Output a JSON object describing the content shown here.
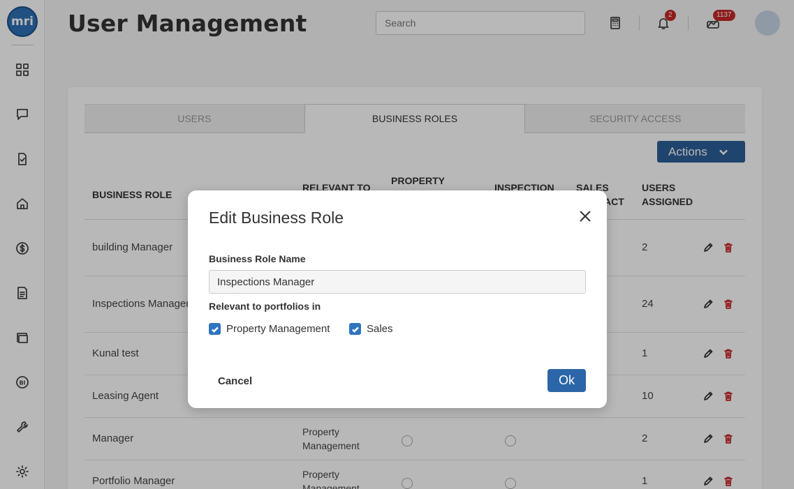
{
  "app": {
    "logo_text": "mri"
  },
  "header": {
    "title": "User Management",
    "search_placeholder": "Search",
    "notifications_count": "2",
    "tasks_count": "1137"
  },
  "sidebar": {
    "items": [
      {
        "icon": "dashboard-icon"
      },
      {
        "icon": "chat-icon"
      },
      {
        "icon": "checklist-icon"
      },
      {
        "icon": "home-icon"
      },
      {
        "icon": "dollar-icon"
      },
      {
        "icon": "report-icon"
      },
      {
        "icon": "frame-icon"
      },
      {
        "icon": "bi-icon",
        "text": "BI"
      },
      {
        "icon": "wrench-icon"
      },
      {
        "icon": "gear-icon"
      }
    ]
  },
  "tabs": [
    {
      "label": "USERS",
      "active": false
    },
    {
      "label": "BUSINESS ROLES",
      "active": true
    },
    {
      "label": "SECURITY ACCESS",
      "active": false
    }
  ],
  "actions_label": "Actions",
  "table": {
    "headers": {
      "role": "BUSINESS ROLE",
      "relevant": "RELEVANT TO",
      "property": "PROPERTY",
      "inspection": "INSPECTION",
      "sales_1": "SALES",
      "sales_2": "ACT",
      "users_1": "USERS",
      "users_2": "ASSIGNED"
    },
    "rows": [
      {
        "role": "building Manager",
        "relevant_1": "",
        "relevant_2": "",
        "users": "2"
      },
      {
        "role": "Inspections Manager",
        "relevant_1": "",
        "relevant_2": "",
        "users": "24"
      },
      {
        "role": "Kunal test",
        "relevant_1": "",
        "relevant_2": "",
        "users": "1"
      },
      {
        "role": "Leasing Agent",
        "relevant_1": "",
        "relevant_2": "",
        "users": "10"
      },
      {
        "role": "Manager",
        "relevant_1": "Property",
        "relevant_2": "Management",
        "users": "2"
      },
      {
        "role": "Portfolio Manager",
        "relevant_1": "Property",
        "relevant_2": "Management",
        "users": "1"
      }
    ]
  },
  "modal": {
    "title": "Edit Business Role",
    "name_label": "Business Role Name",
    "name_value": "Inspections Manager",
    "portfolios_label": "Relevant to portfolios in",
    "checkboxes": [
      {
        "label": "Property Management",
        "checked": true
      },
      {
        "label": "Sales",
        "checked": true
      }
    ],
    "cancel_label": "Cancel",
    "ok_label": "Ok"
  },
  "colors": {
    "primary": "#2c5f99",
    "checkbox": "#2f74c0",
    "delete": "#c62828",
    "badge": "#c62828"
  }
}
